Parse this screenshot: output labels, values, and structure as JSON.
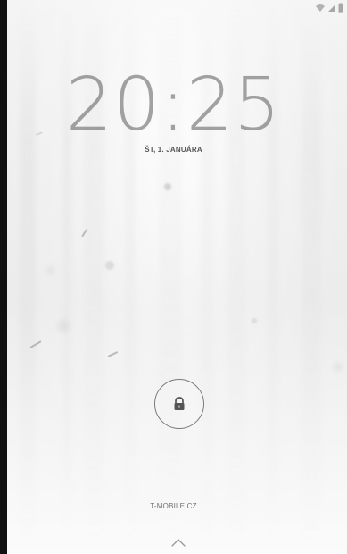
{
  "lockscreen": {
    "time": "20:25",
    "date": "ŠT, 1. JANUÁRA",
    "carrier": "T-MOBILE CZ"
  },
  "status_bar": {
    "icons": [
      "wifi-icon",
      "signal-icon",
      "battery-icon"
    ]
  },
  "unlock": {
    "icon": "lock-icon",
    "swipe_hint_icon": "chevron-up-icon"
  },
  "colors": {
    "text_muted": "#6f6f6f",
    "clock": "#5a5a5a",
    "ring": "#7a7a7a"
  }
}
